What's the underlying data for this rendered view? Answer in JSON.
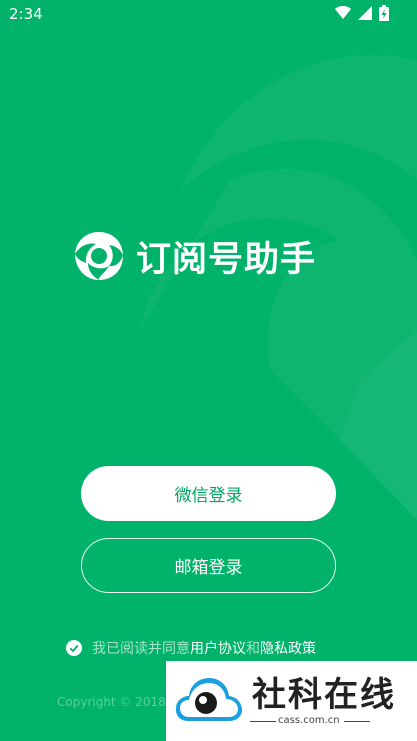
{
  "status_bar": {
    "time": "2:34",
    "icons": [
      "wifi-icon",
      "cell-signal-icon",
      "battery-charging-icon"
    ]
  },
  "app": {
    "name": "订阅号助手",
    "logo_icon": "subscription-assistant-logo"
  },
  "buttons": {
    "wechat_login": "微信登录",
    "email_login": "邮箱登录"
  },
  "agreement": {
    "prefix": "我已阅读并同意",
    "user_agreement": "用户协议",
    "and": "和",
    "privacy_policy": "隐私政策",
    "checked": true
  },
  "footer": {
    "copyright": "Copyright © 2018"
  },
  "watermark": {
    "title": "社科在线",
    "url": "cass.com.cn"
  },
  "colors": {
    "background": "#00b26a",
    "accent": "#00a862",
    "text_on_primary": "#ffffff"
  }
}
